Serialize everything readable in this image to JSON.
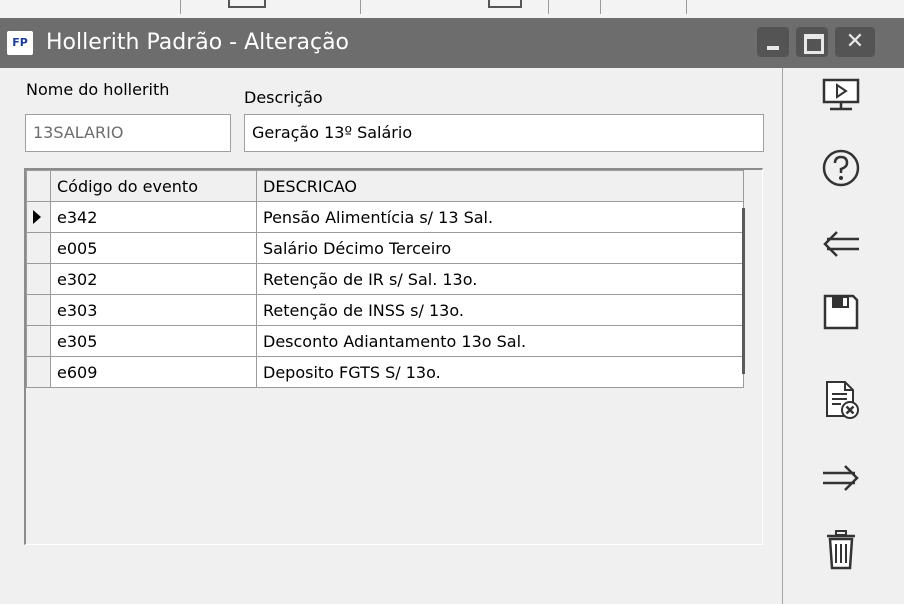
{
  "window": {
    "app_icon_text": "FP",
    "title": "Hollerith Padrão - Alteração",
    "controls": [
      "minimize",
      "maximize",
      "close"
    ],
    "close_glyph": "✕"
  },
  "form": {
    "name_label": "Nome do hollerith",
    "name_value": "13SALARIO",
    "description_label": "Descrição",
    "description_value": "Geração 13º Salário"
  },
  "grid": {
    "columns": [
      "Código do evento",
      "DESCRICAO"
    ],
    "current_row_index": 0,
    "rows": [
      {
        "code": "e342",
        "description": "Pensão Alimentícia s/ 13 Sal."
      },
      {
        "code": "e005",
        "description": "Salário Décimo Terceiro"
      },
      {
        "code": "e302",
        "description": "Retenção de IR s/ Sal. 13o."
      },
      {
        "code": "e303",
        "description": "Retenção de INSS s/ 13o."
      },
      {
        "code": "e305",
        "description": "Desconto Adiantamento 13o Sal."
      },
      {
        "code": "e609",
        "description": "Deposito FGTS S/ 13o."
      }
    ]
  },
  "toolbar": {
    "icons": [
      "monitor-icon",
      "help-icon",
      "back-arrow-icon",
      "save-icon",
      "cancel-document-icon",
      "forward-arrow-icon",
      "trash-icon"
    ]
  },
  "colors": {
    "titlebar": "#6d6d6d",
    "window_buttons": "#545454",
    "app_icon_text": "#1c3f94",
    "icon_stroke": "#333333"
  }
}
